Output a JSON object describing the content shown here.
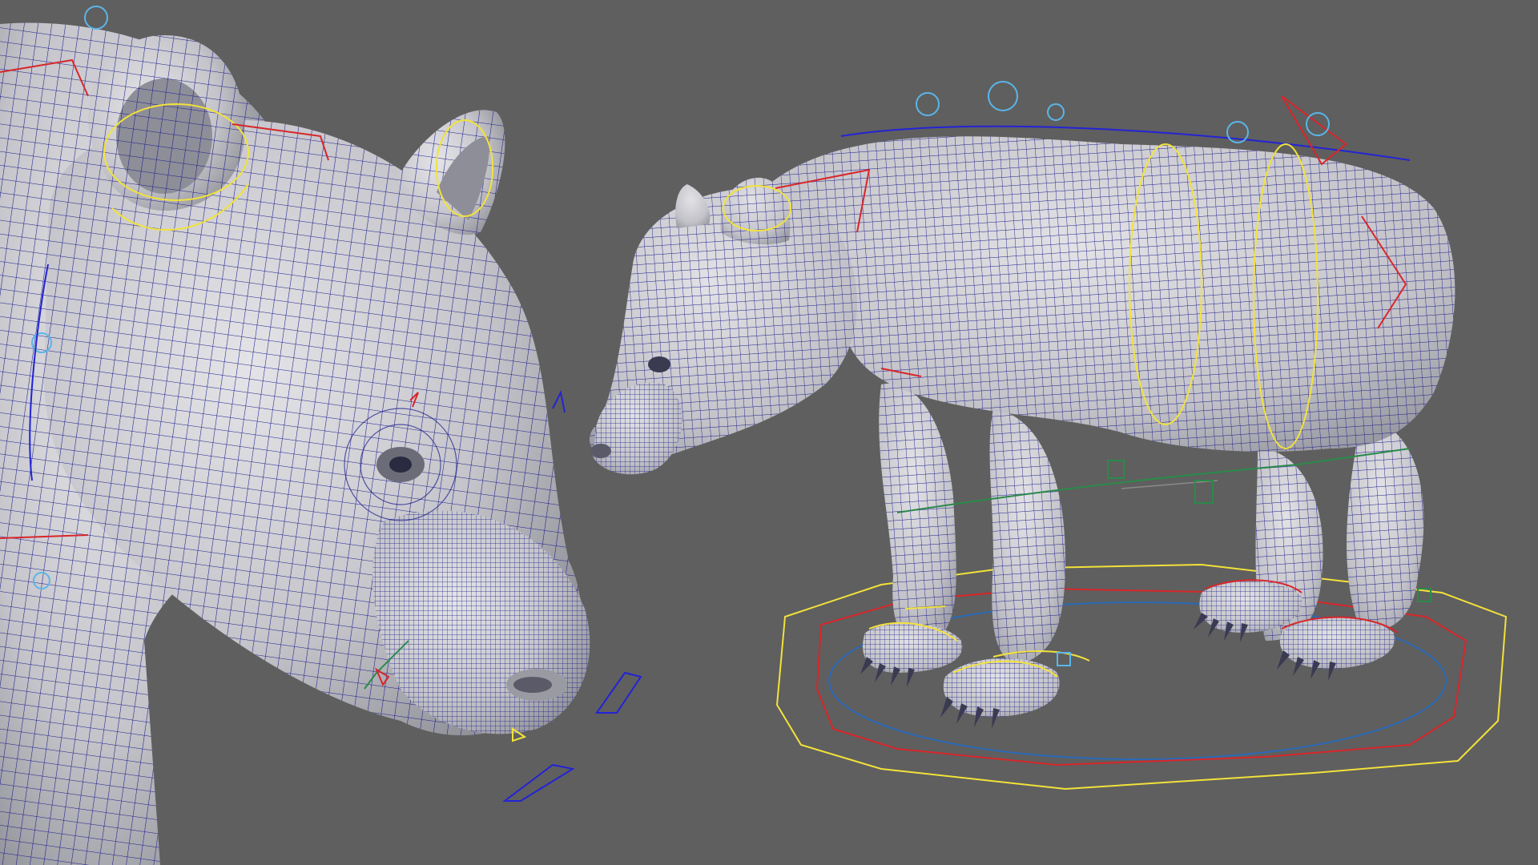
{
  "viewport": {
    "background_color": "#5f5f5f",
    "mesh_fill_color": "#c7c7cc",
    "wireframe_color": "#1c1c8c",
    "rig_colors": {
      "fk_control": "#f2e23a",
      "ik_control": "#d8262a",
      "joint_helper": "#5ab6e8",
      "pole_vector": "#2a8a4a",
      "spine_curve": "#2323d6"
    },
    "models": [
      {
        "name_icon": "bear-head-closeup-mesh"
      },
      {
        "name_icon": "bear-full-body-rigged-mesh"
      }
    ]
  }
}
